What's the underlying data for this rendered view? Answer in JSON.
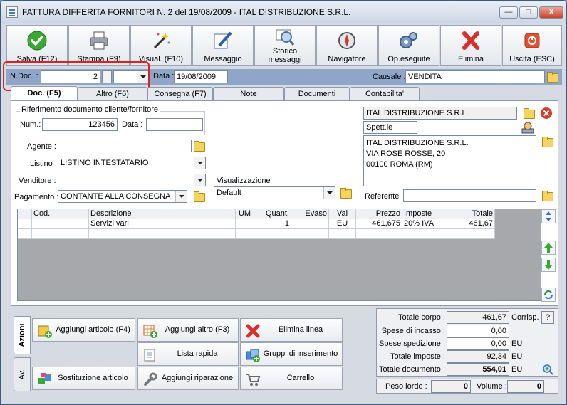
{
  "window": {
    "title": "FATTURA DIFFERITA FORNITORI N. 2  del 19/08/2009 - ITAL DISTRIBUZIONE S.R.L.",
    "min_label": "—",
    "max_label": "□",
    "close_label": "X"
  },
  "toolbar": [
    {
      "label": "Salva (F12)",
      "icon": "check-icon"
    },
    {
      "label": "Stampa (F9)",
      "icon": "printer-icon"
    },
    {
      "label": "Visual. (F10)",
      "icon": "magic-wand-icon"
    },
    {
      "label": "Messaggio",
      "icon": "pen-icon"
    },
    {
      "label": "Storico messaggi",
      "icon": "magnifier-icon"
    },
    {
      "label": "Navigatore",
      "icon": "compass-icon"
    },
    {
      "label": "Op.eseguite",
      "icon": "gears-icon"
    },
    {
      "label": "Elimina",
      "icon": "delete-x-icon"
    },
    {
      "label": "Uscita (ESC)",
      "icon": "exit-icon"
    }
  ],
  "docbar": {
    "ndoc_label": "N.Doc. :",
    "ndoc_value": "2",
    "data_label": "Data :",
    "data_value": "19/08/2009",
    "causale_label": "Causale :",
    "causale_value": "VENDITA"
  },
  "tabs": [
    "Doc. (F5)",
    "Altro (F6)",
    "Consegna (F7)",
    "Note",
    "Documenti",
    "Contabilita'"
  ],
  "riferimento": {
    "title": "Riferimento documento cliente/fornitore",
    "num_label": "Num.:",
    "num_value": "123456",
    "data_label": "Data :",
    "data_value": ""
  },
  "form": {
    "agente_label": "Agente :",
    "agente_value": "",
    "listino_label": "Listino :",
    "listino_value": "LISTINO INTESTATARIO",
    "venditore_label": "Venditore :",
    "venditore_value": "",
    "pagamento_label": "Pagamento :",
    "pagamento_value": "CONTANTE ALLA CONSEGNA",
    "visualizzazione_label": "Visualizzazione",
    "visualizzazione_value": "Default"
  },
  "cliente": {
    "name": "ITAL DISTRIBUZIONE S.R.L.",
    "spett": "Spett.le",
    "address_lines": [
      "ITAL DISTRIBUZIONE S.R.L.",
      "VIA ROSE ROSSE, 20",
      "00100 ROMA (RM)"
    ],
    "referente_label": "Referente",
    "referente_value": ""
  },
  "grid": {
    "headers": [
      "Cod.",
      "Descrizione",
      "UM",
      "Quant.",
      "Evaso",
      "Val",
      "Prezzo",
      "Imposte",
      "Totale"
    ],
    "rows": [
      [
        "",
        "Servizi vari",
        "",
        "1",
        "",
        "EU",
        "461,675",
        "20% IVA",
        "461,67"
      ]
    ]
  },
  "action_tabs": [
    "Azioni",
    "Av."
  ],
  "actions": [
    {
      "label": "Aggiungi articolo (F4)",
      "icon": "add-article-icon"
    },
    {
      "label": "Aggiungi altro (F3)",
      "icon": "add-grid-icon"
    },
    {
      "label": "Elimina linea",
      "icon": "delete-line-icon"
    },
    {
      "label": "Lista rapida",
      "icon": "quick-list-icon"
    },
    {
      "label": "Gruppi di inserimento",
      "icon": "group-insert-icon"
    },
    {
      "label": "Sostituzione articolo",
      "icon": "replace-article-icon"
    },
    {
      "label": "Aggiungi riparazione",
      "icon": "wrench-icon"
    },
    {
      "label": "Carrello",
      "icon": "cart-icon"
    }
  ],
  "totals": {
    "corpo_label": "Totale corpo :",
    "corpo_value": "461,67",
    "corrisp_label": "Corrisp.",
    "help_label": "?",
    "incasso_label": "Spese di incasso :",
    "incasso_value": "0,00",
    "spedizione_label": "Spese spedizione :",
    "spedizione_value": "0,00",
    "spedizione_unit": "EU",
    "imposte_label": "Totale imposte :",
    "imposte_value": "92,34",
    "imposte_unit": "EU",
    "documento_label": "Totale documento :",
    "documento_value": "554,01",
    "documento_unit": "EU"
  },
  "weights": {
    "peso_label": "Peso lordo :",
    "peso_value": "0",
    "volume_label": "Volume :",
    "volume_value": "0"
  },
  "colors": {
    "highlight": "#e02020",
    "docbar": "#8fa6c9"
  }
}
